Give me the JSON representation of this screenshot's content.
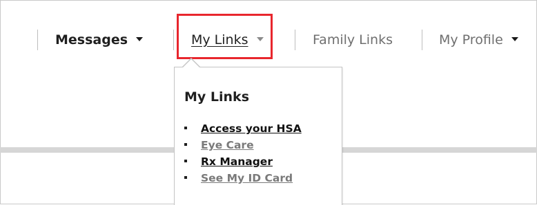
{
  "nav": {
    "messages_label": "Messages",
    "mylinks_label": "My Links",
    "family_label": "Family Links",
    "profile_label": "My Profile"
  },
  "dropdown": {
    "title": "My Links",
    "items": [
      {
        "label": "Access your HSA",
        "style": "dark"
      },
      {
        "label": "Eye Care",
        "style": "grey"
      },
      {
        "label": "Rx Manager",
        "style": "dark"
      },
      {
        "label": "See My ID Card",
        "style": "grey"
      }
    ]
  },
  "colors": {
    "highlight": "#e8262d",
    "text_dark": "#1f1f1f",
    "text_grey": "#6f6f6f",
    "divider": "#bdbdbd",
    "gray_bar": "#d6d6d6"
  },
  "icons": {
    "dropdown_caret": "chevron-down-icon",
    "list_bullet": "bullet-icon"
  }
}
